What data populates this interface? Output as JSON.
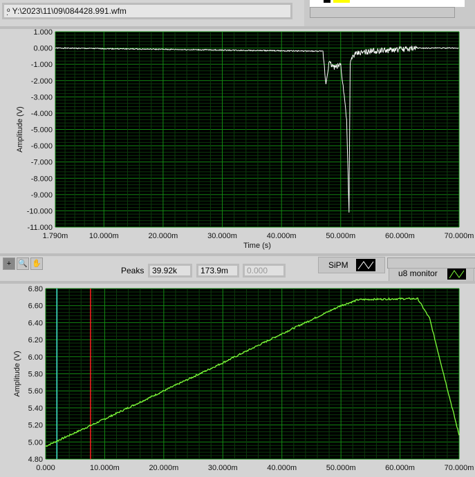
{
  "file_path": "Y:\\2023\\11\\09\\084428.991.wfm",
  "graph1": {
    "ylabel": "Amplitude (V)",
    "xlabel": "Time (s)",
    "yticks": [
      "1.000",
      "0.000",
      "-1.000",
      "-2.000",
      "-3.000",
      "-4.000",
      "-5.000",
      "-6.000",
      "-7.000",
      "-8.000",
      "-9.000",
      "-10.000",
      "-11.000"
    ],
    "xticks": [
      "1.790m",
      "10.000m",
      "20.000m",
      "30.000m",
      "40.000m",
      "50.000m",
      "60.000m",
      "70.000m"
    ],
    "plot_color": "#ffffff"
  },
  "toolbar": {
    "cursor_tool": "+",
    "zoom_tool": "🔍",
    "pan_tool": "✋"
  },
  "peaks": {
    "label": "Peaks",
    "values": [
      "39.92k",
      "173.9m",
      "0.000"
    ]
  },
  "legend": {
    "sipm": "SiPM",
    "u8": "u8 monitor"
  },
  "graph2": {
    "ylabel": "Amplitude (V)",
    "yticks": [
      "6.80",
      "6.60",
      "6.40",
      "6.20",
      "6.00",
      "5.80",
      "5.60",
      "5.40",
      "5.20",
      "5.00",
      "4.80"
    ],
    "xticks": [
      "0.000",
      "10.000m",
      "20.000m",
      "30.000m",
      "40.000m",
      "50.000m",
      "60.000m",
      "70.000m"
    ],
    "plot_color": "#7fff3a",
    "cursor1_ms": 1.9,
    "cursor2_ms": 7.6,
    "cursor1_color": "#40e0d0",
    "cursor2_color": "#ff2020"
  },
  "chart_data": [
    {
      "type": "line",
      "xlabel": "Time (s)",
      "ylabel": "Amplitude (V)",
      "xlim": [
        0.00179,
        0.07
      ],
      "ylim": [
        -11,
        1
      ],
      "x_ms": [
        1.79,
        47,
        47.5,
        48,
        49,
        50,
        51,
        51.4,
        51.6,
        52,
        53,
        55,
        60,
        63,
        70
      ],
      "y": [
        0,
        -0.2,
        -2.2,
        -0.9,
        -1.2,
        -1.0,
        -4.3,
        -10.2,
        -1.0,
        -0.5,
        -0.3,
        -0.2,
        -0.1,
        0,
        0
      ]
    },
    {
      "type": "line",
      "xlabel": "",
      "ylabel": "Amplitude (V)",
      "xlim": [
        0,
        0.07
      ],
      "ylim": [
        4.8,
        6.8
      ],
      "x_ms": [
        0,
        10,
        20,
        30,
        40,
        50,
        53,
        60,
        63,
        65,
        70
      ],
      "y": [
        4.95,
        5.27,
        5.6,
        5.93,
        6.27,
        6.6,
        6.67,
        6.68,
        6.68,
        6.45,
        5.08
      ]
    }
  ]
}
